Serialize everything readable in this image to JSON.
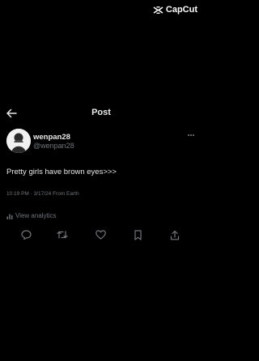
{
  "watermark": {
    "brand": "CapCut",
    "icon": "capcut-logo-icon"
  },
  "header": {
    "back_icon": "arrow-left-icon",
    "title": "Post"
  },
  "post": {
    "author": {
      "display_name": "wenpan28",
      "handle": "@wenpan28",
      "avatar_icon": "avatar-image"
    },
    "more_icon": "more-horizontal-icon",
    "text": "Pretty girls have brown eyes>>>",
    "meta": "10:19 PM · 3/17/24 From Earth",
    "analytics_label": "View analytics"
  },
  "actions": [
    {
      "name": "reply",
      "icon": "reply-icon"
    },
    {
      "name": "repost",
      "icon": "repost-icon"
    },
    {
      "name": "like",
      "icon": "heart-icon"
    },
    {
      "name": "bookmark",
      "icon": "bookmark-icon"
    },
    {
      "name": "share",
      "icon": "share-icon"
    }
  ],
  "colors": {
    "background": "#000000",
    "primary_text": "#e7e9ea",
    "secondary_text": "#71767b"
  }
}
